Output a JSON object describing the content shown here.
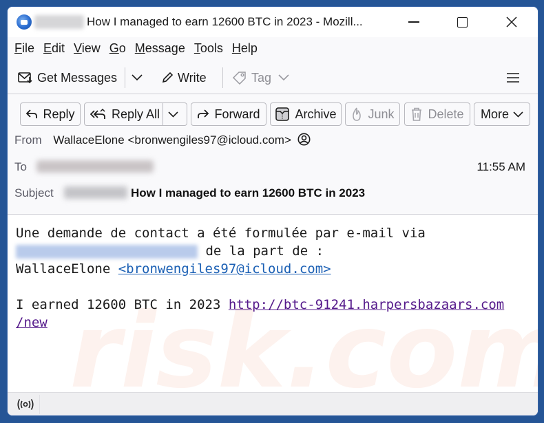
{
  "window": {
    "account_blurred": true,
    "title": "How I managed to earn 12600 BTC in 2023 - Mozill...",
    "controls": [
      "minimize",
      "maximize",
      "close"
    ]
  },
  "menubar": {
    "items": [
      {
        "label_u": "F",
        "label_rest": "ile"
      },
      {
        "label_u": "E",
        "label_rest": "dit"
      },
      {
        "label_u": "V",
        "label_rest": "iew"
      },
      {
        "label_u": "G",
        "label_rest": "o"
      },
      {
        "label_u": "M",
        "label_rest": "essage"
      },
      {
        "label_u": "T",
        "label_rest": "ools"
      },
      {
        "label_u": "H",
        "label_rest": "elp"
      }
    ]
  },
  "toolbar": {
    "get_messages": "Get Messages",
    "write": "Write",
    "tag": "Tag",
    "menu_icon": "hamburger-icon"
  },
  "message_actions": {
    "reply": "Reply",
    "reply_all": "Reply All",
    "forward": "Forward",
    "archive": "Archive",
    "junk": "Junk",
    "delete": "Delete",
    "more": "More"
  },
  "header": {
    "from_label": "From",
    "from_value": "WallaceElone <bronwengiles97@icloud.com>",
    "to_label": "To",
    "to_blurred": true,
    "time": "11:55 AM",
    "subject_label": "Subject",
    "subject_value": "How I managed to earn 12600 BTC in 2023"
  },
  "body": {
    "line1": "Une demande de contact a été formulée par e-mail via",
    "line2_after_link": " de la part de :",
    "line3_name": "WallaceElone ",
    "line3_email": "<bronwengiles97@icloud.com>",
    "line5_text": "I earned 12600 BTC in 2023 ",
    "line5_link": "http://btc-91241.harpersbazaars.com",
    "line6_link": "/new"
  },
  "statusbar": {
    "icon": "activity-broadcast-icon"
  },
  "colors": {
    "desktop": "#255596",
    "link": "#1a5fb4",
    "visited_link": "#551a8b"
  }
}
